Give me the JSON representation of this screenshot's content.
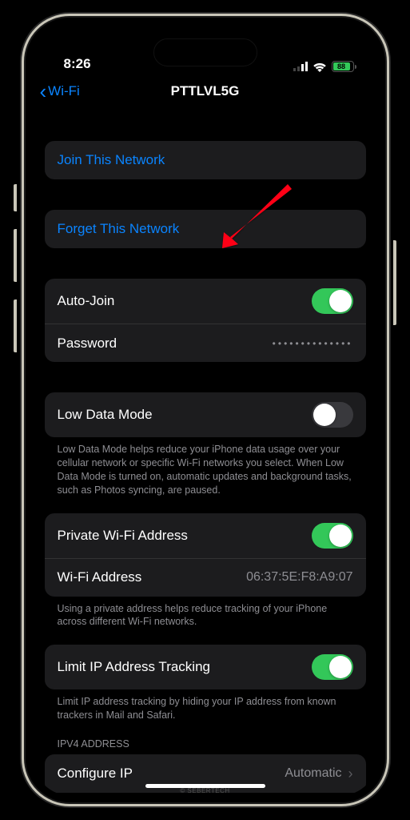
{
  "status": {
    "time": "8:26",
    "battery_pct": "88"
  },
  "nav": {
    "back_label": "Wi-Fi",
    "title": "PTTLVL5G"
  },
  "rows": {
    "join": "Join This Network",
    "forget": "Forget This Network",
    "auto_join": "Auto-Join",
    "password": "Password",
    "password_value": "••••••••••••••",
    "low_data": "Low Data Mode",
    "private_wifi": "Private Wi-Fi Address",
    "wifi_address": "Wi-Fi Address",
    "wifi_address_value": "06:37:5E:F8:A9:07",
    "limit_ip": "Limit IP Address Tracking",
    "configure_ip": "Configure IP",
    "configure_ip_value": "Automatic"
  },
  "footers": {
    "low_data": "Low Data Mode helps reduce your iPhone data usage over your cellular network or specific Wi-Fi networks you select. When Low Data Mode is turned on, automatic updates and background tasks, such as Photos syncing, are paused.",
    "private_wifi": "Using a private address helps reduce tracking of your iPhone across different Wi-Fi networks.",
    "limit_ip": "Limit IP address tracking by hiding your IP address from known trackers in Mail and Safari."
  },
  "headers": {
    "ipv4": "IPV4 ADDRESS"
  },
  "watermark": "© SEBERTECH"
}
